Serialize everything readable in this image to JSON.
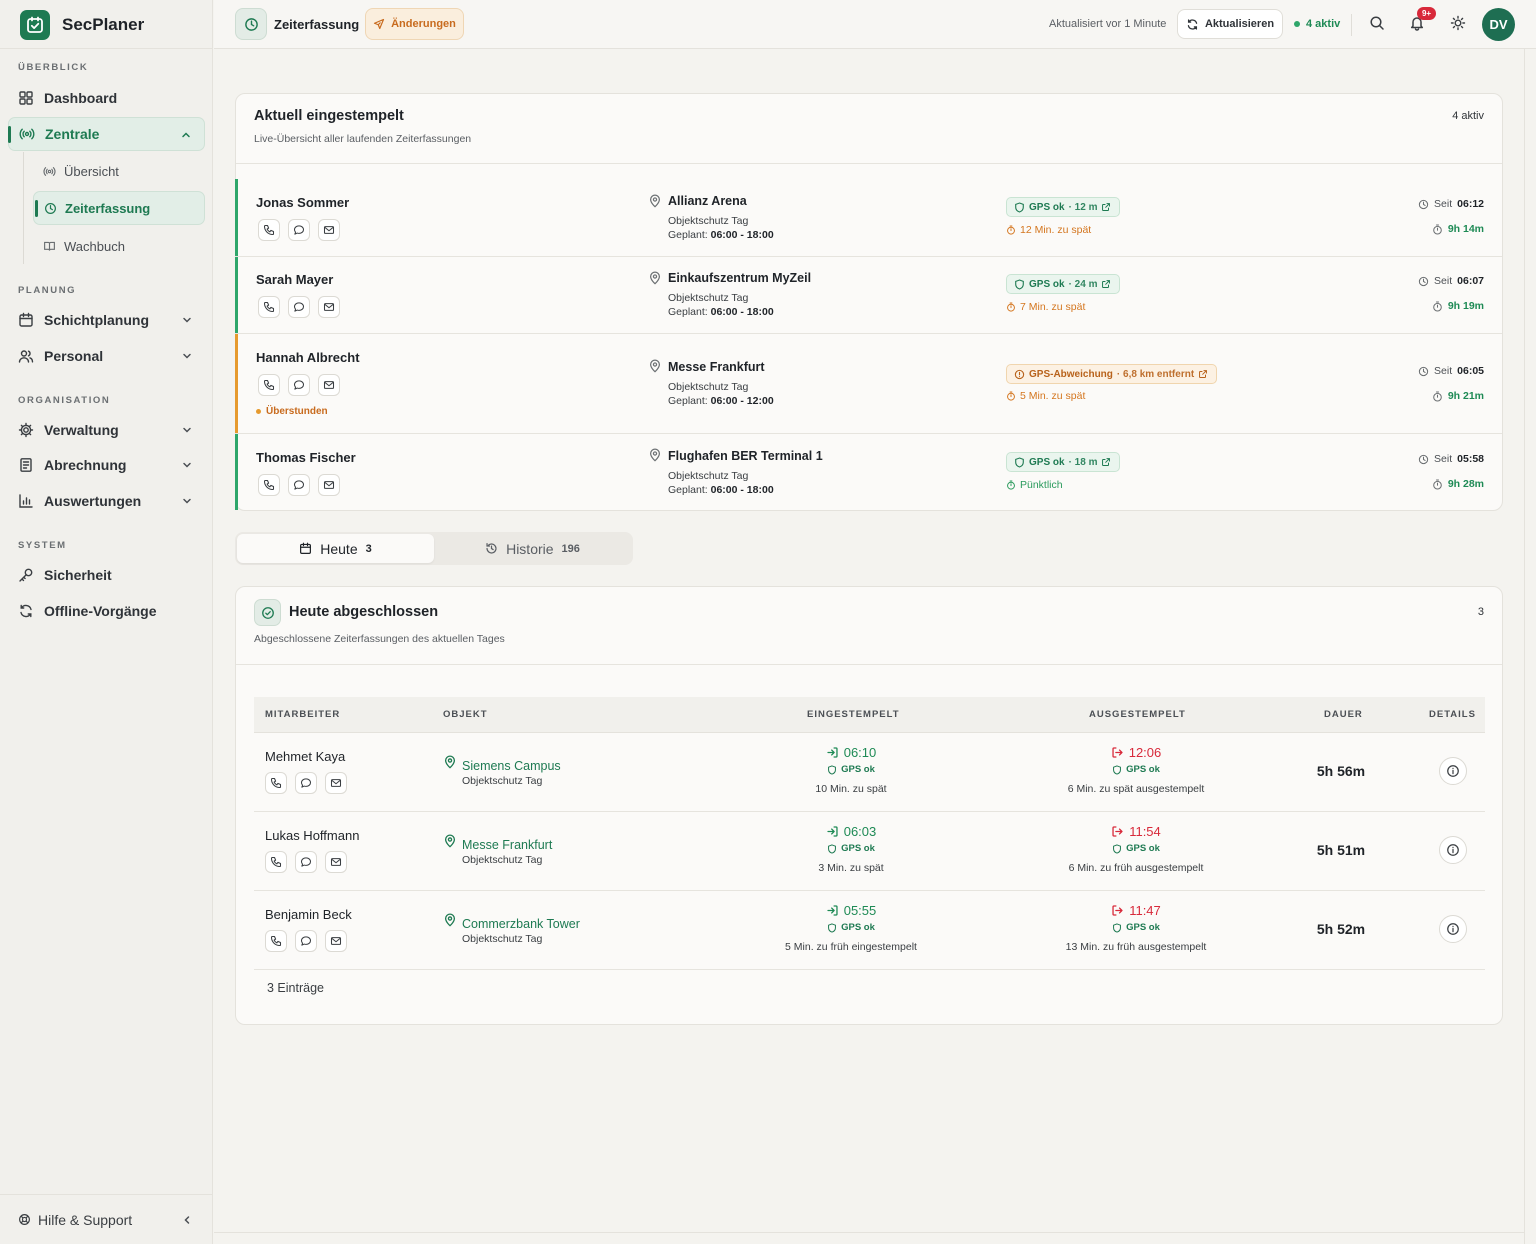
{
  "app": {
    "name": "SecPlaner"
  },
  "sidebar": {
    "sections": {
      "overview": "ÜBERBLICK",
      "planning": "PLANUNG",
      "organisation": "ORGANISATION",
      "system": "SYSTEM"
    },
    "items": {
      "dashboard": "Dashboard",
      "zentrale": "Zentrale",
      "uebersicht": "Übersicht",
      "zeiterfassung": "Zeiterfassung",
      "wachbuch": "Wachbuch",
      "schichtplanung": "Schichtplanung",
      "personal": "Personal",
      "verwaltung": "Verwaltung",
      "abrechnung": "Abrechnung",
      "auswertungen": "Auswertungen",
      "sicherheit": "Sicherheit",
      "offline": "Offline-Vorgänge"
    },
    "help": "Hilfe & Support"
  },
  "topbar": {
    "title": "Zeiterfassung",
    "changes": "Änderungen",
    "updated": "Aktualisiert vor 1 Minute",
    "refresh": "Aktualisieren",
    "active": "4 aktiv",
    "notif_badge": "9+",
    "avatar": "DV"
  },
  "active_card": {
    "title": "Aktuell eingestempelt",
    "subtitle": "Live-Übersicht aller laufenden Zeiterfassungen",
    "count": "4 aktiv",
    "rows": [
      {
        "name": "Jonas Sommer",
        "location": "Allianz Arena",
        "type": "Objektschutz Tag",
        "plan_label": "Geplant:",
        "plan": "06:00 - 18:00",
        "gps": "GPS ok",
        "gps_extra": "· 12 m",
        "late": "12 Min. zu spät",
        "since_label": "Seit",
        "since": "06:12",
        "duration": "9h 14m"
      },
      {
        "name": "Sarah Mayer",
        "location": "Einkaufszentrum MyZeil",
        "type": "Objektschutz Tag",
        "plan_label": "Geplant:",
        "plan": "06:00 - 18:00",
        "gps": "GPS ok",
        "gps_extra": "· 24 m",
        "late": "7 Min. zu spät",
        "since_label": "Seit",
        "since": "06:07",
        "duration": "9h 19m"
      },
      {
        "name": "Hannah Albrecht",
        "flag": "Überstunden",
        "location": "Messe Frankfurt",
        "type": "Objektschutz Tag",
        "plan_label": "Geplant:",
        "plan": "06:00 - 12:00",
        "gps": "GPS-Abweichung",
        "gps_extra": "· 6,8 km entfernt",
        "late": "5 Min. zu spät",
        "since_label": "Seit",
        "since": "06:05",
        "duration": "9h 21m"
      },
      {
        "name": "Thomas Fischer",
        "location": "Flughafen BER Terminal 1",
        "type": "Objektschutz Tag",
        "plan_label": "Geplant:",
        "plan": "06:00 - 18:00",
        "gps": "GPS ok",
        "gps_extra": "· 18 m",
        "late": "Pünktlich",
        "since_label": "Seit",
        "since": "05:58",
        "duration": "9h 28m"
      }
    ]
  },
  "tabs": {
    "today": {
      "label": "Heute",
      "count": "3"
    },
    "history": {
      "label": "Historie",
      "count": "196"
    }
  },
  "done_card": {
    "title": "Heute abgeschlossen",
    "subtitle": "Abgeschlossene Zeiterfassungen des aktuellen Tages",
    "count": "3",
    "headers": {
      "employee": "MITARBEITER",
      "object": "OBJEKT",
      "in": "EINGESTEMPELT",
      "out": "AUSGESTEMPELT",
      "duration": "DAUER",
      "details": "DETAILS"
    },
    "rows": [
      {
        "name": "Mehmet Kaya",
        "object": "Siemens Campus",
        "type": "Objektschutz Tag",
        "in": "06:10",
        "in_gps": "GPS ok",
        "in_note": "10 Min. zu spät",
        "out": "12:06",
        "out_gps": "GPS ok",
        "out_note": "6 Min. zu spät ausgestempelt",
        "duration": "5h 56m"
      },
      {
        "name": "Lukas Hoffmann",
        "object": "Messe Frankfurt",
        "type": "Objektschutz Tag",
        "in": "06:03",
        "in_gps": "GPS ok",
        "in_note": "3 Min. zu spät",
        "out": "11:54",
        "out_gps": "GPS ok",
        "out_note": "6 Min. zu früh ausgestempelt",
        "duration": "5h 51m"
      },
      {
        "name": "Benjamin Beck",
        "object": "Commerzbank Tower",
        "type": "Objektschutz Tag",
        "in": "05:55",
        "in_gps": "GPS ok",
        "in_note": "5 Min. zu früh eingestempelt",
        "out": "11:47",
        "out_gps": "GPS ok",
        "out_note": "13 Min. zu früh ausgestempelt",
        "duration": "5h 52m"
      }
    ],
    "footer": "3 Einträge"
  },
  "colors": {
    "brand": "#1e7a52",
    "warning": "#e69a2e",
    "danger": "#d8293a",
    "success": "#1e8a55"
  }
}
